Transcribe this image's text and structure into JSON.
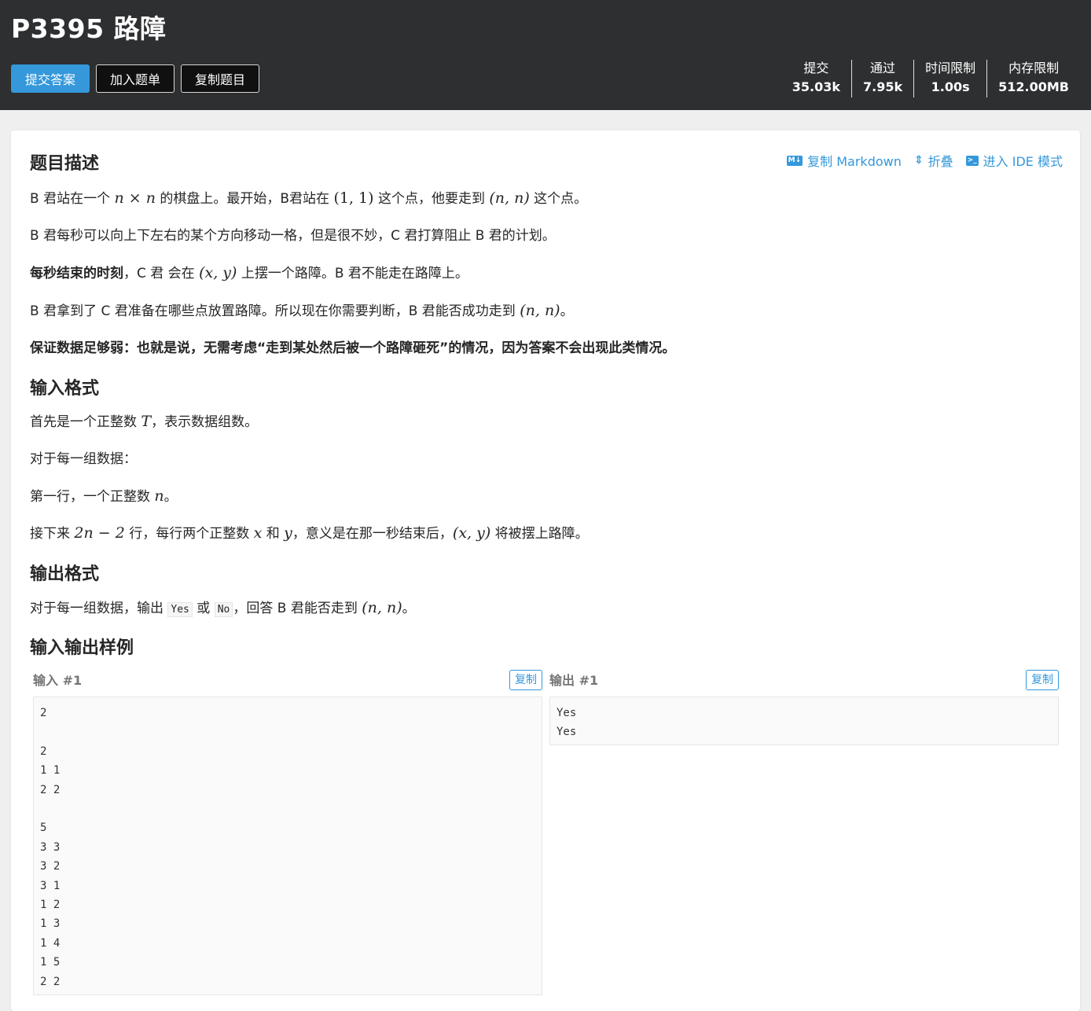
{
  "header": {
    "title": "P3395 路障",
    "buttons": {
      "submit": "提交答案",
      "add_list": "加入题单",
      "copy_problem": "复制题目"
    },
    "stats": [
      {
        "label": "提交",
        "value": "35.03k"
      },
      {
        "label": "通过",
        "value": "7.95k"
      },
      {
        "label": "时间限制",
        "value": "1.00s"
      },
      {
        "label": "内存限制",
        "value": "512.00MB"
      }
    ]
  },
  "toolbar": {
    "copy_markdown": "复制 Markdown",
    "fold": "折叠",
    "ide": "进入 IDE 模式",
    "md_icon": "M↓"
  },
  "sections": {
    "desc": "题目描述",
    "input": "输入格式",
    "output": "输出格式",
    "samples": "输入输出样例"
  },
  "desc": {
    "p1_a": "B 君站在一个 ",
    "p1_m1": "n",
    "p1_x": " × ",
    "p1_m2": "n",
    "p1_b": " 的棋盘上。最开始，B君站在 ",
    "p1_c": "(1, 1)",
    "p1_d": " 这个点，他要走到 ",
    "p1_e": "(n, n)",
    "p1_f": " 这个点。",
    "p2": "B 君每秒可以向上下左右的某个方向移动一格，但是很不妙，C 君打算阻止 B 君的计划。",
    "p3_bold": "每秒结束的时刻",
    "p3_a": "，C 君 会在 ",
    "p3_m": "(x, y)",
    "p3_b": " 上摆一个路障。B 君不能走在路障上。",
    "p4_a": "B 君拿到了 C 君准备在哪些点放置路障。所以现在你需要判断，B 君能否成功走到 ",
    "p4_m": "(n, n)",
    "p4_b": "。",
    "p5": "保证数据足够弱：也就是说，无需考虑“走到某处然后被一个路障砸死”的情况，因为答案不会出现此类情况。"
  },
  "input": {
    "p1_a": "首先是一个正整数 ",
    "p1_m": "T",
    "p1_b": "，表示数据组数。",
    "p2": "对于每一组数据：",
    "p3_a": "第一行，一个正整数 ",
    "p3_m": "n",
    "p3_b": "。",
    "p4_a": "接下来 ",
    "p4_m": "2n − 2",
    "p4_b": " 行，每行两个正整数 ",
    "p4_x": "x",
    "p4_c": " 和 ",
    "p4_y": "y",
    "p4_d": "，意义是在那一秒结束后，",
    "p4_xy": "(x, y)",
    "p4_e": " 将被摆上路障。"
  },
  "output": {
    "p1_a": "对于每一组数据，输出 ",
    "yes": "Yes",
    "p1_b": " 或 ",
    "no": "No",
    "p1_c": "，回答 B 君能否走到 ",
    "p1_m": "(n, n)",
    "p1_d": "。"
  },
  "samples": {
    "input_title": "输入 #1",
    "output_title": "输出 #1",
    "copy": "复制",
    "input_text": "2\n\n2\n1 1\n2 2\n\n5\n3 3\n3 2\n3 1\n1 2\n1 3\n1 4\n1 5\n2 2",
    "output_text": "Yes\nYes"
  }
}
